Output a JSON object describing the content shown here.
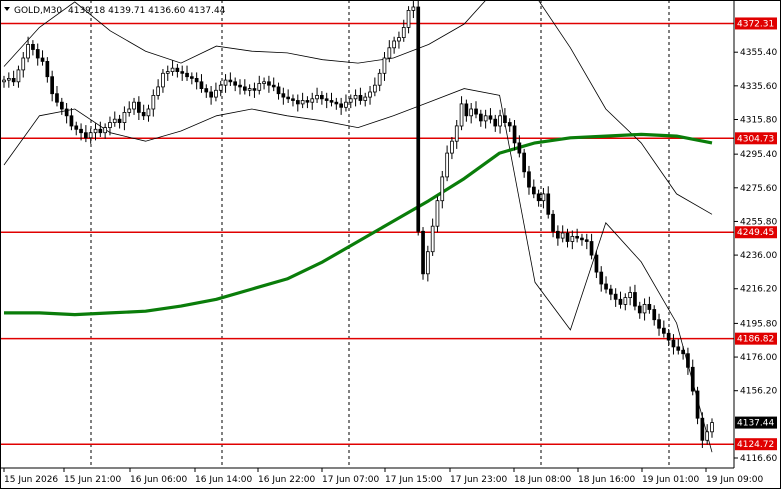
{
  "header": {
    "symbol": "GOLD,M30",
    "ohlc": "4139.18 4139.71 4136.60 4137.44"
  },
  "chart_data": {
    "type": "candlestick",
    "title": "GOLD,M30",
    "ylim": [
      4116.6,
      4392.0
    ],
    "grid": false,
    "y_ticks": [
      4355.4,
      4335.6,
      4315.8,
      4295.4,
      4275.6,
      4255.8,
      4236.0,
      4216.2,
      4195.8,
      4176.0,
      4156.2,
      4116.6
    ],
    "x_ticks": [
      "15 Jun 2026",
      "15 Jun 21:00",
      "16 Jun 06:00",
      "16 Jun 14:00",
      "16 Jun 22:00",
      "17 Jun 07:00",
      "17 Jun 15:00",
      "17 Jun 23:00",
      "18 Jun 08:00",
      "18 Jun 16:00",
      "19 Jun 01:00",
      "19 Jun 09:00"
    ],
    "vertical_dividers": [
      "15 Jun 21:00",
      "16 Jun 14:00",
      "17 Jun 07:00",
      "18 Jun 08:00",
      "19 Jun 01:00"
    ],
    "levels": [
      4372.31,
      4304.73,
      4249.45,
      4186.82,
      4124.72
    ],
    "current_price": 4137.44,
    "closes": [
      4339,
      4340,
      4338,
      4345,
      4352,
      4360,
      4357,
      4352,
      4350,
      4341,
      4331,
      4326,
      4322,
      4318,
      4312,
      4310,
      4308,
      4305,
      4308,
      4310,
      4308,
      4311,
      4314,
      4316,
      4314,
      4320,
      4322,
      4326,
      4320,
      4318,
      4322,
      4330,
      4335,
      4343,
      4344,
      4346,
      4344,
      4343,
      4341,
      4340,
      4338,
      4334,
      4332,
      4329,
      4333,
      4336,
      4339,
      4338,
      4336,
      4335,
      4333,
      4334,
      4333,
      4337,
      4338,
      4336,
      4335,
      4331,
      4329,
      4328,
      4327,
      4325,
      4327,
      4326,
      4328,
      4330,
      4328,
      4327,
      4326,
      4325,
      4323,
      4326,
      4328,
      4330,
      4327,
      4329,
      4332,
      4336,
      4343,
      4352,
      4358,
      4362,
      4364,
      4370,
      4380,
      4382,
      4250,
      4225,
      4238,
      4253,
      4268,
      4282,
      4296,
      4303,
      4312,
      4325,
      4318,
      4322,
      4319,
      4315,
      4318,
      4316,
      4312,
      4318,
      4314,
      4312,
      4302,
      4296,
      4285,
      4276,
      4272,
      4268,
      4272,
      4260,
      4250,
      4246,
      4249,
      4244,
      4247,
      4246,
      4245,
      4244,
      4236,
      4226,
      4219,
      4216,
      4213,
      4210,
      4207,
      4211,
      4214,
      4206,
      4202,
      4207,
      4204,
      4198,
      4193,
      4190,
      4186,
      4182,
      4180,
      4178,
      4170,
      4156,
      4140,
      4127,
      4132,
      4137.44
    ],
    "ma_label": "green moving average",
    "ma_line": [
      4202,
      4202,
      4201,
      4202,
      4203,
      4206,
      4210,
      4216,
      4222,
      4232,
      4244,
      4256,
      4268,
      4281,
      4296,
      4302,
      4305,
      4306,
      4307,
      4306,
      4302
    ],
    "bollinger_upper": [
      4347,
      4370,
      4385,
      4368,
      4356,
      4349,
      4359,
      4356,
      4355,
      4351,
      4349,
      4352,
      4360,
      4372,
      4395,
      4389,
      4358,
      4322,
      4302,
      4272,
      4260
    ],
    "bollinger_lower": [
      4289,
      4318,
      4322,
      4308,
      4303,
      4309,
      4318,
      4322,
      4318,
      4315,
      4311,
      4318,
      4326,
      4334,
      4330,
      4220,
      4192,
      4255,
      4232,
      4196,
      4120
    ]
  }
}
